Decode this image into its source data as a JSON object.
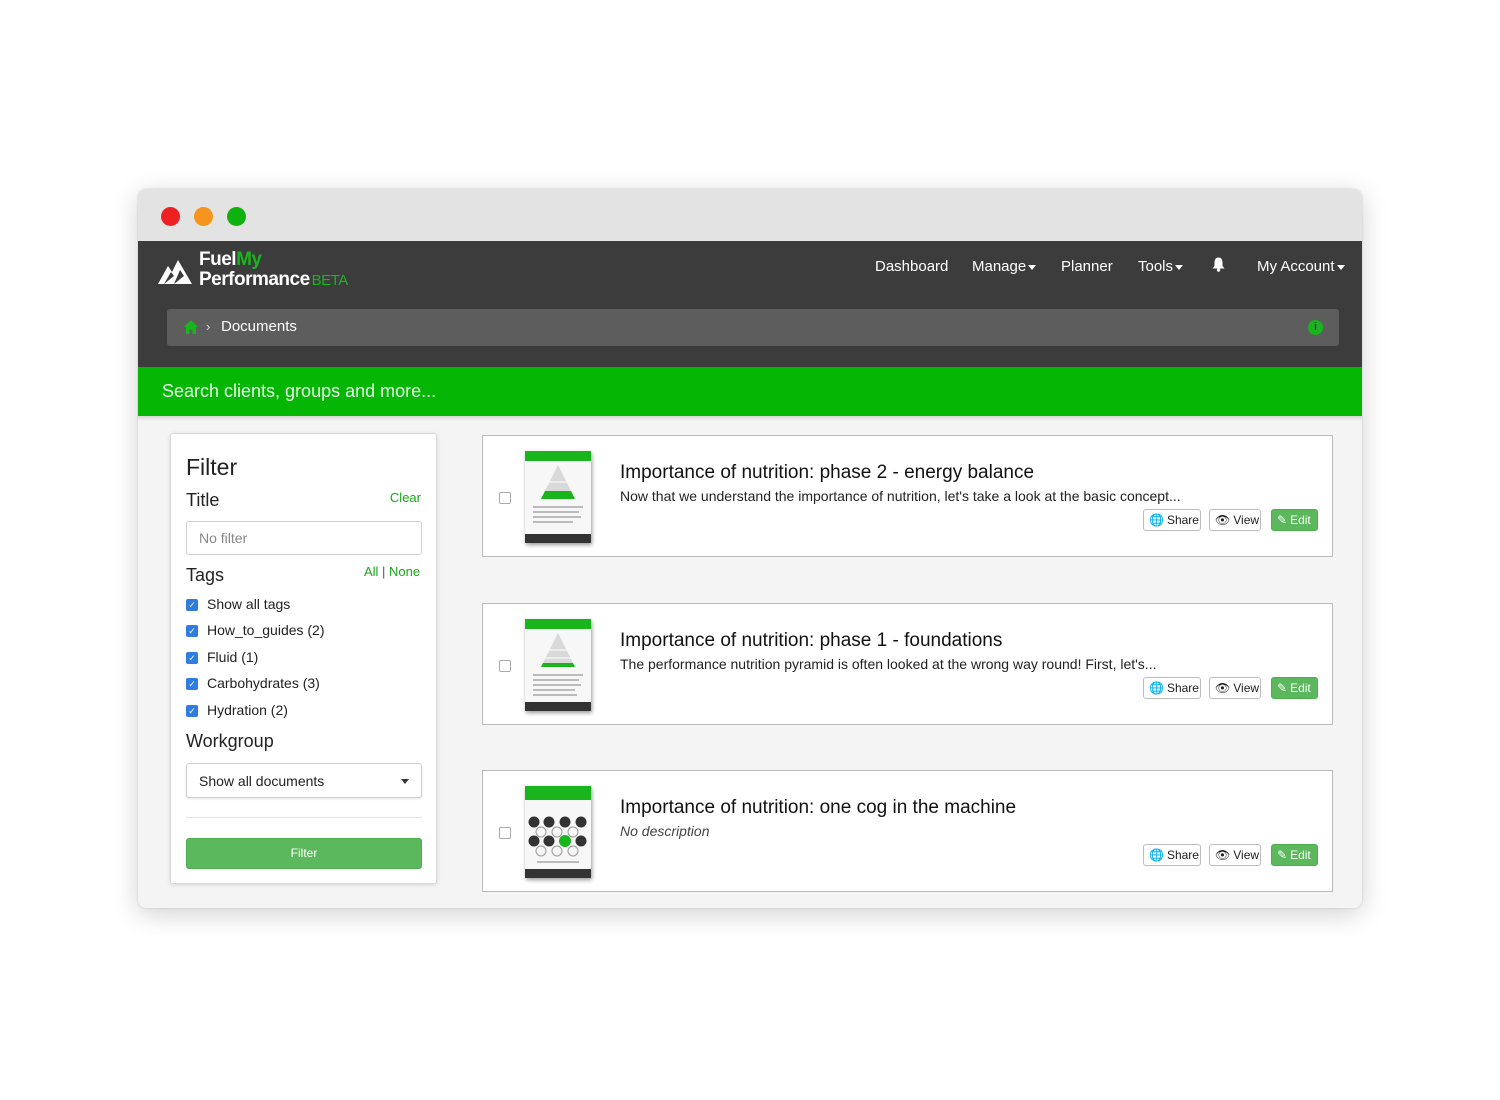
{
  "brand": {
    "line1_a": "Fuel",
    "line1_b": "My",
    "line2": "Performance",
    "beta": "BETA"
  },
  "nav": {
    "dashboard": "Dashboard",
    "manage": "Manage",
    "planner": "Planner",
    "tools": "Tools",
    "account": "My Account"
  },
  "breadcrumb": {
    "separator": "›",
    "current": "Documents"
  },
  "search": {
    "placeholder": "Search clients, groups and more..."
  },
  "filter": {
    "heading": "Filter",
    "title_label": "Title",
    "clear": "Clear",
    "title_placeholder": "No filter",
    "tags_label": "Tags",
    "all": "All",
    "sep": "|",
    "none": "None",
    "tags": [
      {
        "label": "Show all tags",
        "checked": true
      },
      {
        "label": "How_to_guides (2)",
        "checked": true
      },
      {
        "label": "Fluid (1)",
        "checked": true
      },
      {
        "label": "Carbohydrates (3)",
        "checked": true
      },
      {
        "label": "Hydration (2)",
        "checked": true
      }
    ],
    "workgroup_label": "Workgroup",
    "workgroup_value": "Show all documents",
    "button": "Filter"
  },
  "documents": [
    {
      "title": "Importance of nutrition: phase 2 - energy balance",
      "description": "Now that we understand the importance of nutrition, let's take a look at the basic concept...",
      "thumbnail": "pyramid"
    },
    {
      "title": "Importance of nutrition: phase 1 - foundations",
      "description": "The performance nutrition pyramid is often looked at the wrong way round! First, let's...",
      "thumbnail": "pyramid"
    },
    {
      "title": "Importance of nutrition: one cog in the machine",
      "description": "No description",
      "thumbnail": "cogs"
    }
  ],
  "actions": {
    "share": "Share",
    "view": "View",
    "edit": "Edit"
  },
  "colors": {
    "brand_green": "#19b51c",
    "search_green": "#05b605",
    "navbar": "#3c3c3c",
    "button_green": "#5cb85c"
  }
}
